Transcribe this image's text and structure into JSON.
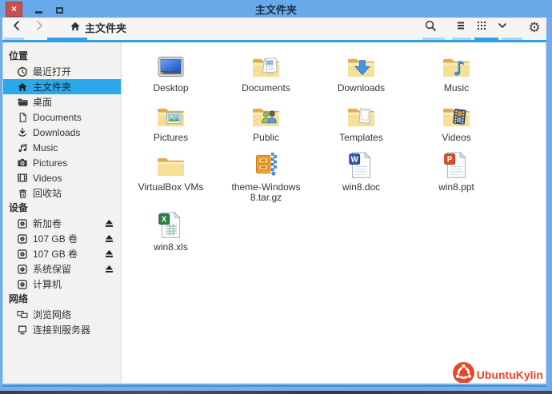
{
  "window": {
    "title": "主文件夹"
  },
  "titlebar": {
    "buttons": [
      {
        "id": "close",
        "icon": "close-icon",
        "glyph": "×"
      },
      {
        "id": "minimize",
        "icon": "minimize-icon"
      },
      {
        "id": "maximize",
        "icon": "maximize-icon"
      }
    ]
  },
  "toolbar": {
    "back": {
      "icon": "back-icon"
    },
    "forward": {
      "icon": "forward-icon"
    },
    "breadcrumb": {
      "icon": "home-icon",
      "label": "主文件夹"
    },
    "right_buttons": [
      {
        "id": "search",
        "icon": "search-icon"
      },
      {
        "id": "list-view",
        "icon": "list-view-icon"
      },
      {
        "id": "grid-view",
        "icon": "grid-view-icon",
        "active": true
      },
      {
        "id": "expand",
        "icon": "chevron-down-icon"
      },
      {
        "id": "settings",
        "icon": "gear-icon"
      }
    ]
  },
  "sidebar": {
    "sections": [
      {
        "header": "位置",
        "items": [
          {
            "id": "recent",
            "icon": "clock",
            "label": "最近打开"
          },
          {
            "id": "home",
            "icon": "home",
            "label": "主文件夹",
            "selected": true
          },
          {
            "id": "desktop",
            "icon": "folder",
            "label": "桌面"
          },
          {
            "id": "documents",
            "icon": "document",
            "label": "Documents"
          },
          {
            "id": "downloads",
            "icon": "download",
            "label": "Downloads"
          },
          {
            "id": "music",
            "icon": "music",
            "label": "Music"
          },
          {
            "id": "pictures",
            "icon": "camera",
            "label": "Pictures"
          },
          {
            "id": "videos",
            "icon": "film",
            "label": "Videos"
          },
          {
            "id": "trash",
            "icon": "trash",
            "label": "回收站"
          }
        ]
      },
      {
        "header": "设备",
        "items": [
          {
            "id": "volume-new",
            "icon": "disk",
            "label": "新加卷",
            "eject": true
          },
          {
            "id": "volume-107-1",
            "icon": "disk",
            "label": "107 GB 卷",
            "eject": true
          },
          {
            "id": "volume-107-2",
            "icon": "disk",
            "label": "107 GB 卷",
            "eject": true
          },
          {
            "id": "system-reserved",
            "icon": "disk",
            "label": "系统保留",
            "eject": true
          },
          {
            "id": "computer",
            "icon": "disk",
            "label": "计算机"
          }
        ]
      },
      {
        "header": "网络",
        "items": [
          {
            "id": "browse-network",
            "icon": "network",
            "label": "浏览网络"
          },
          {
            "id": "connect-server",
            "icon": "server",
            "label": "连接到服务器"
          }
        ]
      }
    ]
  },
  "files": [
    {
      "name": "Desktop",
      "icon": "desktop"
    },
    {
      "name": "Documents",
      "icon": "folder-documents"
    },
    {
      "name": "Downloads",
      "icon": "folder-downloads"
    },
    {
      "name": "Music",
      "icon": "folder-music"
    },
    {
      "name": "Pictures",
      "icon": "folder-pictures"
    },
    {
      "name": "Public",
      "icon": "folder-public"
    },
    {
      "name": "Templates",
      "icon": "folder-templates"
    },
    {
      "name": "Videos",
      "icon": "folder-videos"
    },
    {
      "name": "VirtualBox VMs",
      "icon": "folder"
    },
    {
      "name": "theme-Windows 8.tar.gz",
      "icon": "archive"
    },
    {
      "name": "win8.doc",
      "icon": "doc"
    },
    {
      "name": "win8.ppt",
      "icon": "ppt"
    },
    {
      "name": "win8.xls",
      "icon": "xls"
    }
  ],
  "branding": {
    "logo_text": "UbuntuKylin",
    "logo_icon": "ubuntukylin-logo-icon"
  },
  "colors": {
    "titlebar": "#68a9e9",
    "frame": "#74abe6",
    "toolbar_bg": "#f7f5f3",
    "selection": "#2aa8ea",
    "close_button": "#c9504e",
    "accent_line": "#2e9fe8",
    "sidebar_bg": "#f4f2f0",
    "logo_orange": "#e8472a",
    "folder_yellow": "#f6df96"
  }
}
